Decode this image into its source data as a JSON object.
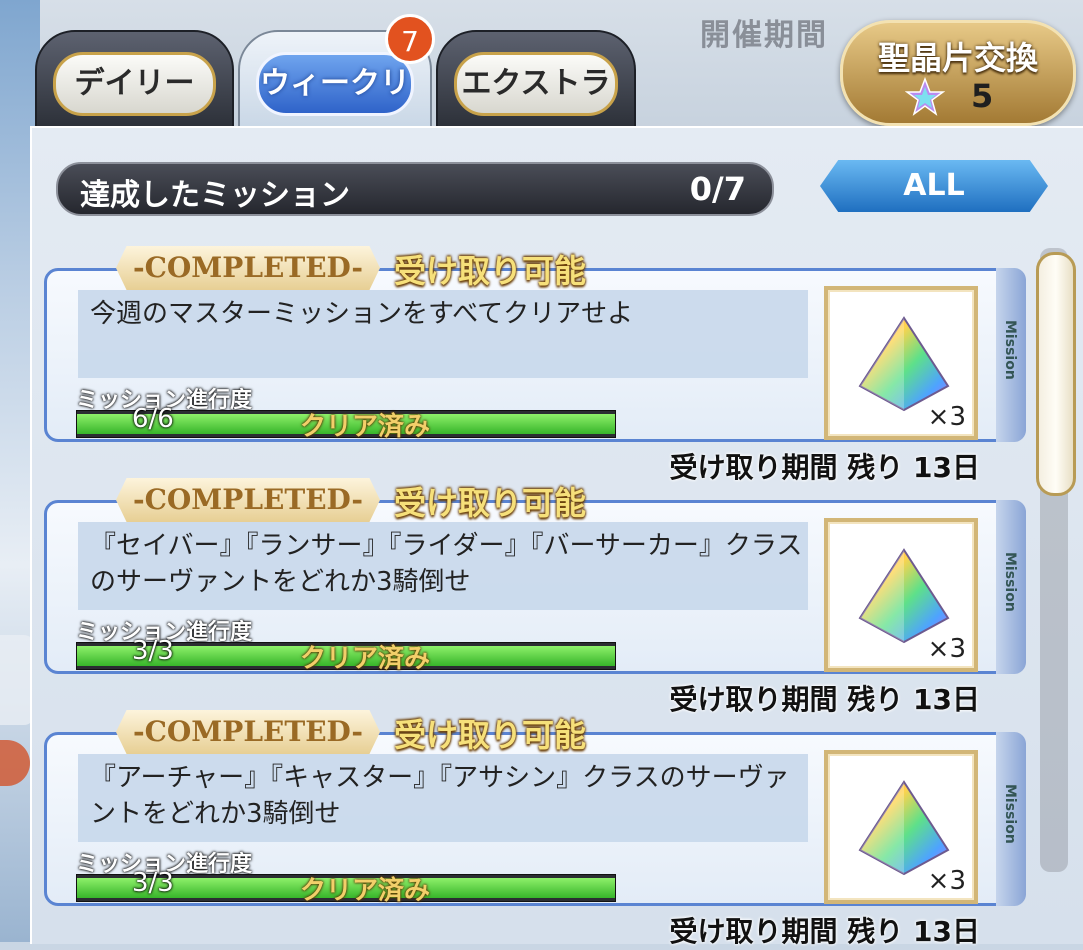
{
  "tabs": [
    {
      "label": "デイリー"
    },
    {
      "label": "ウィークリー",
      "badge": "7"
    },
    {
      "label": "エクストラ"
    }
  ],
  "exchange": {
    "title": "聖晶片交換",
    "count": "5"
  },
  "achieved": {
    "label": "達成したミッション",
    "count": "0/7"
  },
  "filter": {
    "label": "ALL"
  },
  "missions": [
    {
      "completed": "-COMPLETED-",
      "claimable": "受け取り可能",
      "description": "今週のマスターミッションをすべてクリアせよ",
      "progress_label": "ミッション進行度",
      "progress_count": "6/6",
      "progress_fraction": 1.0,
      "status": "クリア済み",
      "reward_qty": "×3",
      "deadline": "受け取り期間 残り 13日",
      "stripe": "Mission"
    },
    {
      "completed": "-COMPLETED-",
      "claimable": "受け取り可能",
      "description": "『セイバー』『ランサー』『ライダー』『バーサーカー』クラスのサーヴァントをどれか3騎倒せ",
      "progress_label": "ミッション進行度",
      "progress_count": "3/3",
      "progress_fraction": 1.0,
      "status": "クリア済み",
      "reward_qty": "×3",
      "deadline": "受け取り期間 残り 13日",
      "stripe": "Mission"
    },
    {
      "completed": "-COMPLETED-",
      "claimable": "受け取り可能",
      "description": "『アーチャー』『キャスター』『アサシン』クラスのサーヴァントをどれか3騎倒せ",
      "progress_label": "ミッション進行度",
      "progress_count": "3/3",
      "progress_fraction": 1.0,
      "status": "クリア済み",
      "reward_qty": "×3",
      "deadline": "受け取り期間 残り 13日",
      "stripe": "Mission"
    }
  ],
  "background_header": "開催期間",
  "colors": {
    "accent_blue": "#2f63c9",
    "badge": "#e2521f",
    "progress_green": "#37b52a",
    "gold": "#f2cf6a"
  }
}
